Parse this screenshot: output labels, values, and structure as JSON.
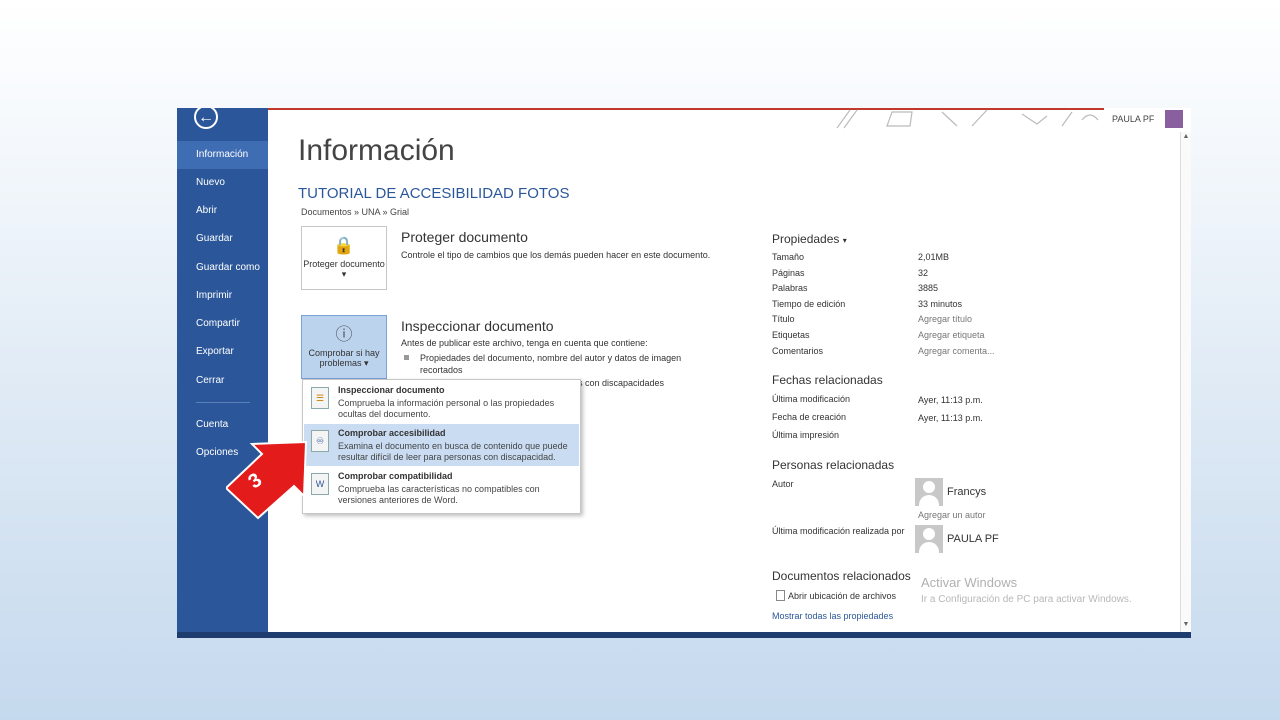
{
  "sidebar": {
    "items": [
      {
        "label": "Información",
        "active": true
      },
      {
        "label": "Nuevo"
      },
      {
        "label": "Abrir"
      },
      {
        "label": "Guardar"
      },
      {
        "label": "Guardar como"
      },
      {
        "label": "Imprimir"
      },
      {
        "label": "Compartir"
      },
      {
        "label": "Exportar"
      },
      {
        "label": "Cerrar"
      },
      {
        "label": "Cuenta"
      },
      {
        "label": "Opciones"
      }
    ]
  },
  "header": {
    "user_name": "PAULA PF"
  },
  "main": {
    "title": "Información",
    "doc_title": "TUTORIAL DE ACCESIBILIDAD FOTOS",
    "path": "Documentos » UNA » Grial",
    "protect": {
      "button_label": "Proteger documento",
      "title": "Proteger documento",
      "desc": "Controle el tipo de cambios que los demás pueden hacer en este documento."
    },
    "inspect": {
      "button_label": "Comprobar si hay problemas",
      "title": "Inspeccionar documento",
      "desc": "Antes de publicar este archivo, tenga en cuenta que contiene:",
      "bullet1": "Propiedades del documento, nombre del autor y datos de imagen recortados",
      "bullet2": "as con discapacidades"
    },
    "menu": [
      {
        "title": "Inspeccionar documento",
        "desc": "Comprueba la información personal o las propiedades ocultas del documento."
      },
      {
        "title": "Comprobar accesibilidad",
        "desc": "Examina el documento en busca de contenido que puede resultar difícil de leer para personas con discapacidad."
      },
      {
        "title": "Comprobar compatibilidad",
        "desc": "Comprueba las características no compatibles con versiones anteriores de Word."
      }
    ]
  },
  "properties": {
    "header": "Propiedades",
    "rows": [
      {
        "label": "Tamaño",
        "value": "2,01MB"
      },
      {
        "label": "Páginas",
        "value": "32"
      },
      {
        "label": "Palabras",
        "value": "3885"
      },
      {
        "label": "Tiempo de edición",
        "value": "33 minutos"
      },
      {
        "label": "Título",
        "value": "Agregar título"
      },
      {
        "label": "Etiquetas",
        "value": "Agregar etiqueta"
      },
      {
        "label": "Comentarios",
        "value": "Agregar comenta..."
      }
    ],
    "dates_header": "Fechas relacionadas",
    "dates": [
      {
        "label": "Última modificación",
        "value": "Ayer, 11:13 p.m."
      },
      {
        "label": "Fecha de creación",
        "value": "Ayer, 11:13 p.m."
      },
      {
        "label": "Última impresión",
        "value": ""
      }
    ],
    "people_header": "Personas relacionadas",
    "author_label": "Autor",
    "author_name": "Francys",
    "add_author": "Agregar un autor",
    "modified_by_label": "Última modificación realizada por",
    "modified_by_name": "PAULA PF",
    "docs_header": "Documentos relacionados",
    "open_location": "Abrir ubicación de archivos",
    "show_all": "Mostrar todas las propiedades"
  },
  "watermark": {
    "line1": "Activar Windows",
    "line2": "Ir a Configuración de PC para activar Windows."
  },
  "annotation": {
    "number": "3",
    "color": "#e31b1b"
  },
  "colors": {
    "sidebar": "#2b579a",
    "accent": "#2b579a",
    "highlight": "#c9dcf2"
  }
}
